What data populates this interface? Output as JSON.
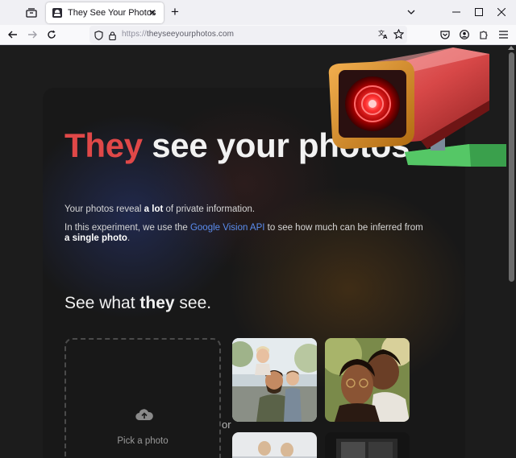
{
  "browser": {
    "tab_title": "They See Your Photos",
    "url_scheme": "https://",
    "url_host": "theyseeyourphotos.com"
  },
  "hero": {
    "word_red": "They",
    "rest": " see your photos"
  },
  "intro": {
    "line1_pre": "Your photos reveal ",
    "line1_bold": "a lot",
    "line1_post": " of private information.",
    "line2_pre": "In this experiment, we use the ",
    "line2_link": "Google Vision API",
    "line2_mid": " to see how much can be inferred from ",
    "line2_bold": "a single photo",
    "line2_post": "."
  },
  "section": {
    "pre": "See what ",
    "bold": "they",
    "post": " see."
  },
  "upload": {
    "label": "Pick a photo",
    "icon": "cloud-upload-icon"
  },
  "or_text": "or",
  "colors": {
    "accent_red": "#e04848",
    "link_blue": "#5b8def",
    "page_bg": "#1c1c1c"
  }
}
